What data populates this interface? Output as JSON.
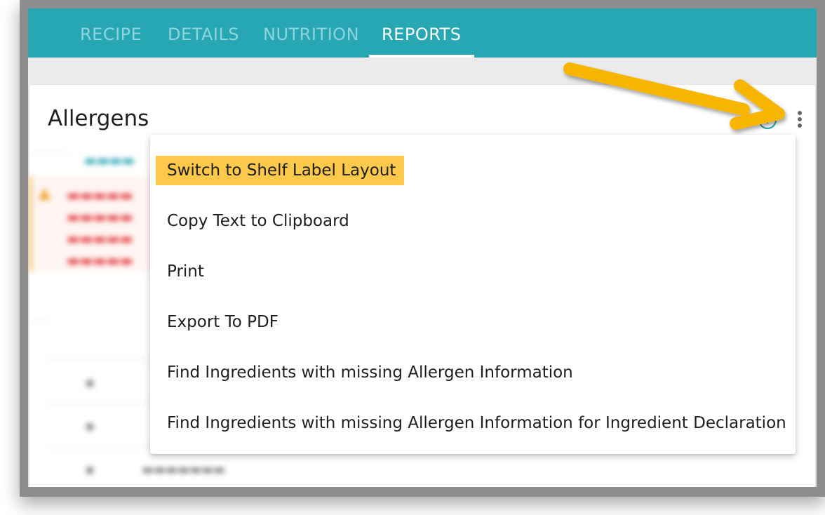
{
  "tabs": [
    {
      "label": "RECIPE"
    },
    {
      "label": "DETAILS"
    },
    {
      "label": "NUTRITION"
    },
    {
      "label": "REPORTS",
      "active": true
    }
  ],
  "card": {
    "title": "Allergens",
    "info_icon": "info-icon",
    "menu_icon": "kebab-menu-icon"
  },
  "menu": {
    "items": [
      {
        "label": "Switch to Shelf Label Layout",
        "highlighted": true
      },
      {
        "label": "Copy Text to Clipboard"
      },
      {
        "label": "Print"
      },
      {
        "label": "Export To PDF"
      },
      {
        "label": "Find Ingredients with missing Allergen Information"
      },
      {
        "label": "Find Ingredients with missing Allergen Information for Ingredient Declaration"
      }
    ]
  },
  "colors": {
    "header": "#27a6b4",
    "highlight": "#fcc94a",
    "arrow": "#f7b500"
  }
}
